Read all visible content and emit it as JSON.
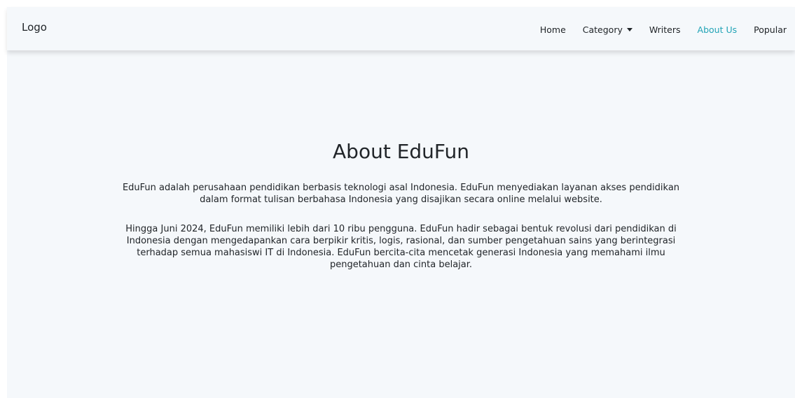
{
  "navbar": {
    "logo": "Logo",
    "items": [
      {
        "label": "Home"
      },
      {
        "label": "Category"
      },
      {
        "label": "Writers"
      },
      {
        "label": "About Us"
      },
      {
        "label": "Popular"
      }
    ],
    "active_item": "About Us"
  },
  "main": {
    "title": "About EduFun",
    "paragraphs": [
      "EduFun adalah perusahaan pendidikan berbasis teknologi asal Indonesia. EduFun menyediakan layanan akses pendidikan dalam format tulisan berbahasa Indonesia yang disajikan secara online melalui website.",
      "Hingga Juni 2024, EduFun memiliki lebih dari 10 ribu pengguna. EduFun hadir sebagai bentuk revolusi dari pendidikan di Indonesia dengan mengedapankan cara berpikir kritis, logis, rasional, dan sumber pengetahuan sains yang berintegrasi terhadap semua mahasiswi IT di Indonesia. EduFun bercita-cita mencetak generasi Indonesia yang memahami ilmu pengetahuan dan cinta belajar."
    ]
  },
  "colors": {
    "background": "#f5f8fb",
    "text": "#212529",
    "active_link": "#21a3b6"
  },
  "icons": {
    "category_dropdown": "caret-down-icon"
  }
}
